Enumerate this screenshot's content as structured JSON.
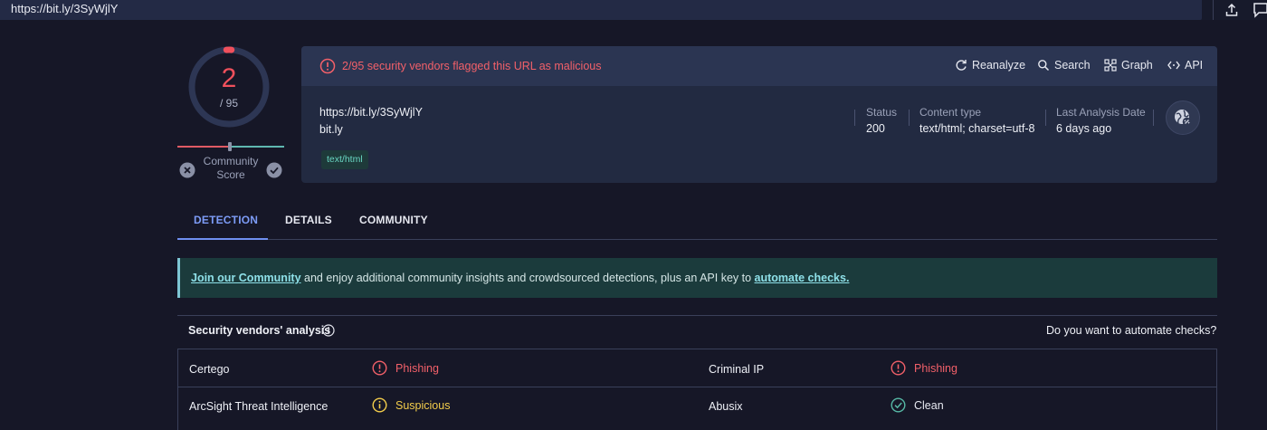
{
  "browser": {
    "url": "https://bit.ly/3SyWjlY",
    "icons": [
      "share-icon",
      "chat-icon"
    ]
  },
  "score": {
    "detections": "2",
    "total": "/ 95",
    "detection_fraction": 0.021
  },
  "community": {
    "label_line1": "Community",
    "label_line2": "Score"
  },
  "summary": {
    "alert": "2/95 security vendors flagged this URL as malicious",
    "actions": {
      "reanalyze": "Reanalyze",
      "search": "Search",
      "graph": "Graph",
      "api": "API"
    },
    "url": "https://bit.ly/3SyWjlY",
    "host": "bit.ly",
    "tag": "text/html",
    "status_label": "Status",
    "status_value": "200",
    "content_type_label": "Content type",
    "content_type_value": "text/html; charset=utf-8",
    "last_analysis_label": "Last Analysis Date",
    "last_analysis_value": "6 days ago"
  },
  "tabs": {
    "detection": "DETECTION",
    "details": "DETAILS",
    "community": "COMMUNITY"
  },
  "banner": {
    "link1": "Join our Community",
    "middle": " and enjoy additional community insights and crowdsourced detections, plus an API key to ",
    "link2": "automate checks."
  },
  "vendors": {
    "title": "Security vendors' analysis",
    "automate_question": "Do you want to automate checks?",
    "rows": [
      {
        "left_name": "Certego",
        "left_verdict": "Phishing",
        "right_name": "Criminal IP",
        "right_verdict": "Phishing"
      },
      {
        "left_name": "ArcSight Threat Intelligence",
        "left_verdict": "Suspicious",
        "right_name": "Abusix",
        "right_verdict": "Clean"
      }
    ]
  },
  "colors": {
    "malicious": "#f26069",
    "suspicious": "#f3cd4b",
    "clean": "#57b9a6",
    "accent": "#7d9cf7"
  }
}
